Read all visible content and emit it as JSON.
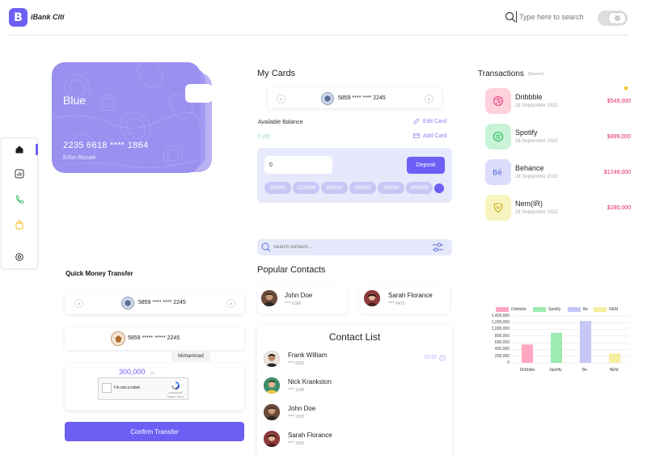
{
  "header": {
    "logo_letter": "B",
    "brand": "iBank Citi",
    "search_placeholder": "Type here to search"
  },
  "sidenav": {
    "items": [
      {
        "icon": "home-icon"
      },
      {
        "icon": "chart-icon"
      },
      {
        "icon": "phone-icon"
      },
      {
        "icon": "bag-icon"
      },
      {
        "icon": "settings-icon"
      }
    ]
  },
  "card": {
    "name": "Blue",
    "number": "2235 6618 **** 1864",
    "holder": "Erfan Rezaie"
  },
  "my_cards": {
    "title": "My Cards",
    "selected_card": "5859 **** **** 2245",
    "available_balance_label": "Available Balance",
    "available_balance_value": "0 (R)",
    "edit_card": "Edit Card",
    "add_card": "Add Card",
    "deposit_value": "0",
    "deposit_button": "Deposit",
    "amount_chips": [
      "200000",
      "1200000",
      "600000",
      "500000",
      "100000",
      "1800000"
    ]
  },
  "transactions": {
    "title": "Transactions",
    "subtitle": "(Recent)",
    "items": [
      {
        "name": "Dribbble",
        "date": "28 September 2022",
        "amount": "$549,000",
        "color": "#ffd1dc",
        "icon": "dribbble-icon"
      },
      {
        "name": "Spotify",
        "date": "28 September 2022",
        "amount": "$899,000",
        "color": "#c9f3d6",
        "icon": "spotify-icon"
      },
      {
        "name": "Behance",
        "date": "28 September 2022",
        "amount": "$1249,000",
        "color": "#dcdcfb",
        "icon": "behance-icon"
      },
      {
        "name": "Nem(IR)",
        "date": "28 September 2022",
        "amount": "$280,000",
        "color": "#f7f4c0",
        "icon": "nem-icon"
      }
    ]
  },
  "contacts": {
    "search_placeholder": "Search contacts...",
    "popular_title": "Popular Contacts",
    "popular": [
      {
        "name": "John Doe",
        "number": "**** 6390"
      },
      {
        "name": "Sarah Florance",
        "number": "**** 6473"
      }
    ],
    "list_title": "Contact List",
    "list": [
      {
        "name": "Frank William",
        "number": "**** 6920"
      },
      {
        "name": "Nick Krankston",
        "number": "**** 1240"
      },
      {
        "name": "John Doe",
        "number": "**** 2020"
      },
      {
        "name": "Sarah Florance",
        "number": "**** 3030"
      }
    ],
    "time": "07:07"
  },
  "quick_transfer": {
    "title": "Quick Money Transfer",
    "source_card": "5859 **** **** 2245",
    "destination_card": "5859 ***** ***** 2245",
    "destination_name": "Mohammad",
    "amount": "300,000",
    "amount_unit": "(R)",
    "captcha_label": "I'm not a robot",
    "captcha_brand": "reCAPTCHA",
    "captcha_links": "Privacy - Terms",
    "confirm_button": "Confirm Transfer"
  },
  "chart_data": {
    "type": "bar",
    "categories": [
      "Dribbble",
      "Spotify",
      "Be",
      "NEM"
    ],
    "series": [
      {
        "name": "Dribbble",
        "values": [
          549000
        ],
        "color": "#ffa6c0"
      },
      {
        "name": "Spotify",
        "values": [
          899000
        ],
        "color": "#9cebb0"
      },
      {
        "name": "Be",
        "values": [
          1249000
        ],
        "color": "#c6c6f7"
      },
      {
        "name": "NEM",
        "values": [
          280000
        ],
        "color": "#f5ef9e"
      }
    ],
    "values": [
      549000,
      899000,
      1249000,
      280000
    ],
    "colors": [
      "#ffa6c0",
      "#9cebb0",
      "#c6c6f7",
      "#f5ef9e"
    ],
    "y_ticks": [
      "1,400,000",
      "1,200,000",
      "1,000,000",
      "800,000",
      "600,000",
      "400,000",
      "200,000",
      "0"
    ],
    "x_ticks": [
      "Dribbble",
      "Spotify",
      "Be",
      "NEM"
    ],
    "ylim": [
      0,
      1400000
    ],
    "grid": true,
    "legend": "top"
  }
}
